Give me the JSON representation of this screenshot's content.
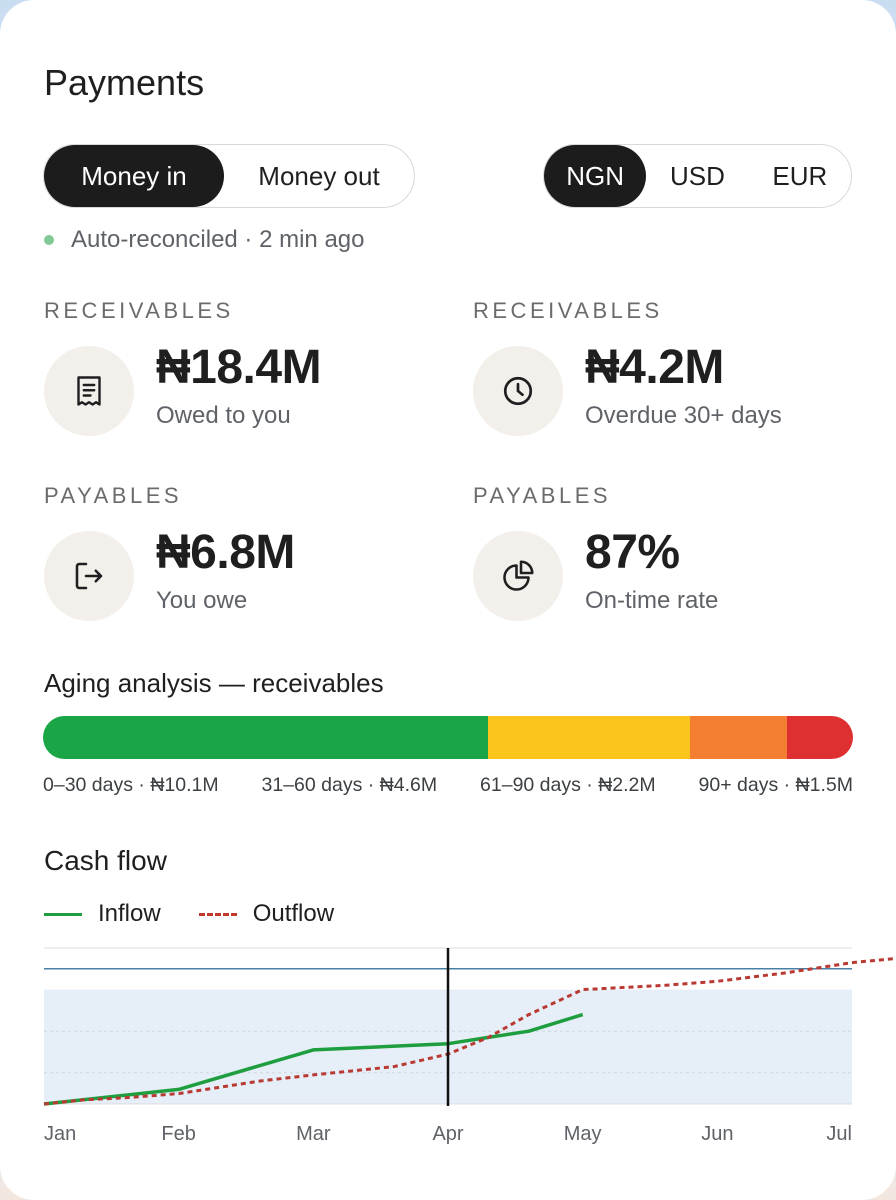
{
  "title": "Payments",
  "flow_toggle": {
    "options": [
      "Money in",
      "Money out"
    ],
    "selected": "Money in"
  },
  "currency_toggle": {
    "options": [
      "NGN",
      "USD",
      "EUR"
    ],
    "selected": "NGN"
  },
  "status": {
    "text": "Auto-reconciled · 2 min ago",
    "color": "#81c995"
  },
  "kpis": [
    {
      "category": "RECEIVABLES",
      "value": "₦18.4M",
      "caption": "Owed to you",
      "icon": "receipt-icon"
    },
    {
      "category": "RECEIVABLES",
      "value": "₦4.2M",
      "caption": "Overdue 30+ days",
      "icon": "clock-icon"
    },
    {
      "category": "PAYABLES",
      "value": "₦6.8M",
      "caption": "You owe",
      "icon": "logout-arrow-icon"
    },
    {
      "category": "PAYABLES",
      "value": "87%",
      "caption": "On-time rate",
      "icon": "pie-chart-icon"
    }
  ],
  "aging": {
    "title": "Aging analysis — receivables",
    "buckets": [
      {
        "label": "0–30 days · ₦10.1M",
        "amount_m": 10.1,
        "color": "#1aa647"
      },
      {
        "label": "31–60 days · ₦4.6M",
        "amount_m": 4.6,
        "color": "#fbc51b"
      },
      {
        "label": "61–90 days · ₦2.2M",
        "amount_m": 2.2,
        "color": "#f47f32"
      },
      {
        "label": "90+ days · ₦1.5M",
        "amount_m": 1.5,
        "color": "#de3030"
      }
    ]
  },
  "cash_flow": {
    "title": "Cash flow",
    "legend": {
      "inflow": "Inflow",
      "outflow": "Outflow"
    },
    "colors": {
      "inflow": "#1e9e3e",
      "outflow": "#b93a32",
      "reference": "#4a7fa6",
      "band": "#e6eef8"
    }
  },
  "chart_data": {
    "type": "line",
    "title": "Cash flow",
    "xlabel": "",
    "ylabel": "",
    "categories": [
      "Jan",
      "Feb",
      "Mar",
      "Apr",
      "May",
      "Jun",
      "Jul"
    ],
    "x": [
      0,
      0.3,
      0.6,
      1,
      1.6,
      2,
      2.6,
      3,
      3.3,
      3.6,
      4,
      4.6,
      5,
      5.5,
      6,
      6.5,
      7
    ],
    "series": [
      {
        "name": "Inflow",
        "style": "solid",
        "values": [
          0,
          null,
          null,
          0.7,
          null,
          2.6,
          null,
          2.9,
          3.2,
          3.5,
          4.3,
          null,
          null,
          null,
          null,
          null,
          null
        ]
      },
      {
        "name": "Outflow",
        "style": "dashed",
        "values": [
          0,
          0.2,
          0.3,
          0.5,
          1.1,
          1.4,
          1.8,
          2.4,
          3.2,
          4.3,
          5.5,
          5.7,
          5.9,
          6.3,
          6.8,
          7.1,
          7.1
        ]
      }
    ],
    "marker_x": "Apr",
    "reference_line_y": 6.5,
    "band_y": [
      0,
      5.5
    ],
    "ylim": [
      0,
      7.5
    ],
    "grid": true,
    "legend_position": "top-left"
  }
}
